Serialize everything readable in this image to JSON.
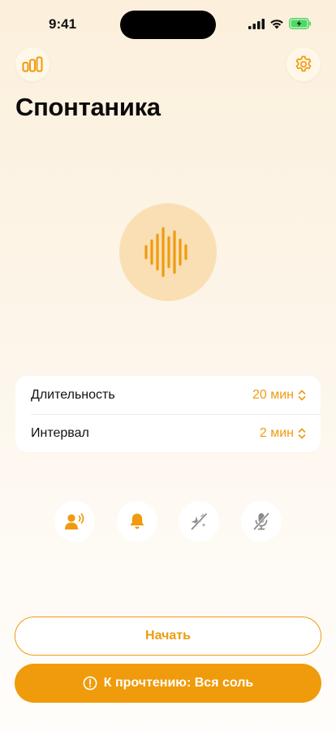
{
  "status_bar": {
    "time": "9:41"
  },
  "header": {
    "title": "Спонтаника"
  },
  "settings": {
    "rows": [
      {
        "label": "Длительность",
        "value": "20 мин"
      },
      {
        "label": "Интервал",
        "value": "2 мин"
      }
    ]
  },
  "toggles": [
    {
      "icon": "voice-prompt-icon"
    },
    {
      "icon": "bell-icon"
    },
    {
      "icon": "sparkles-off-icon"
    },
    {
      "icon": "microphone-off-icon"
    }
  ],
  "actions": {
    "start_label": "Начать",
    "reading_label": "К прочтению: Вся соль"
  },
  "colors": {
    "accent": "#ef9b0f",
    "wave_bg": "#f9dfb3",
    "battery": "#4cd964"
  }
}
